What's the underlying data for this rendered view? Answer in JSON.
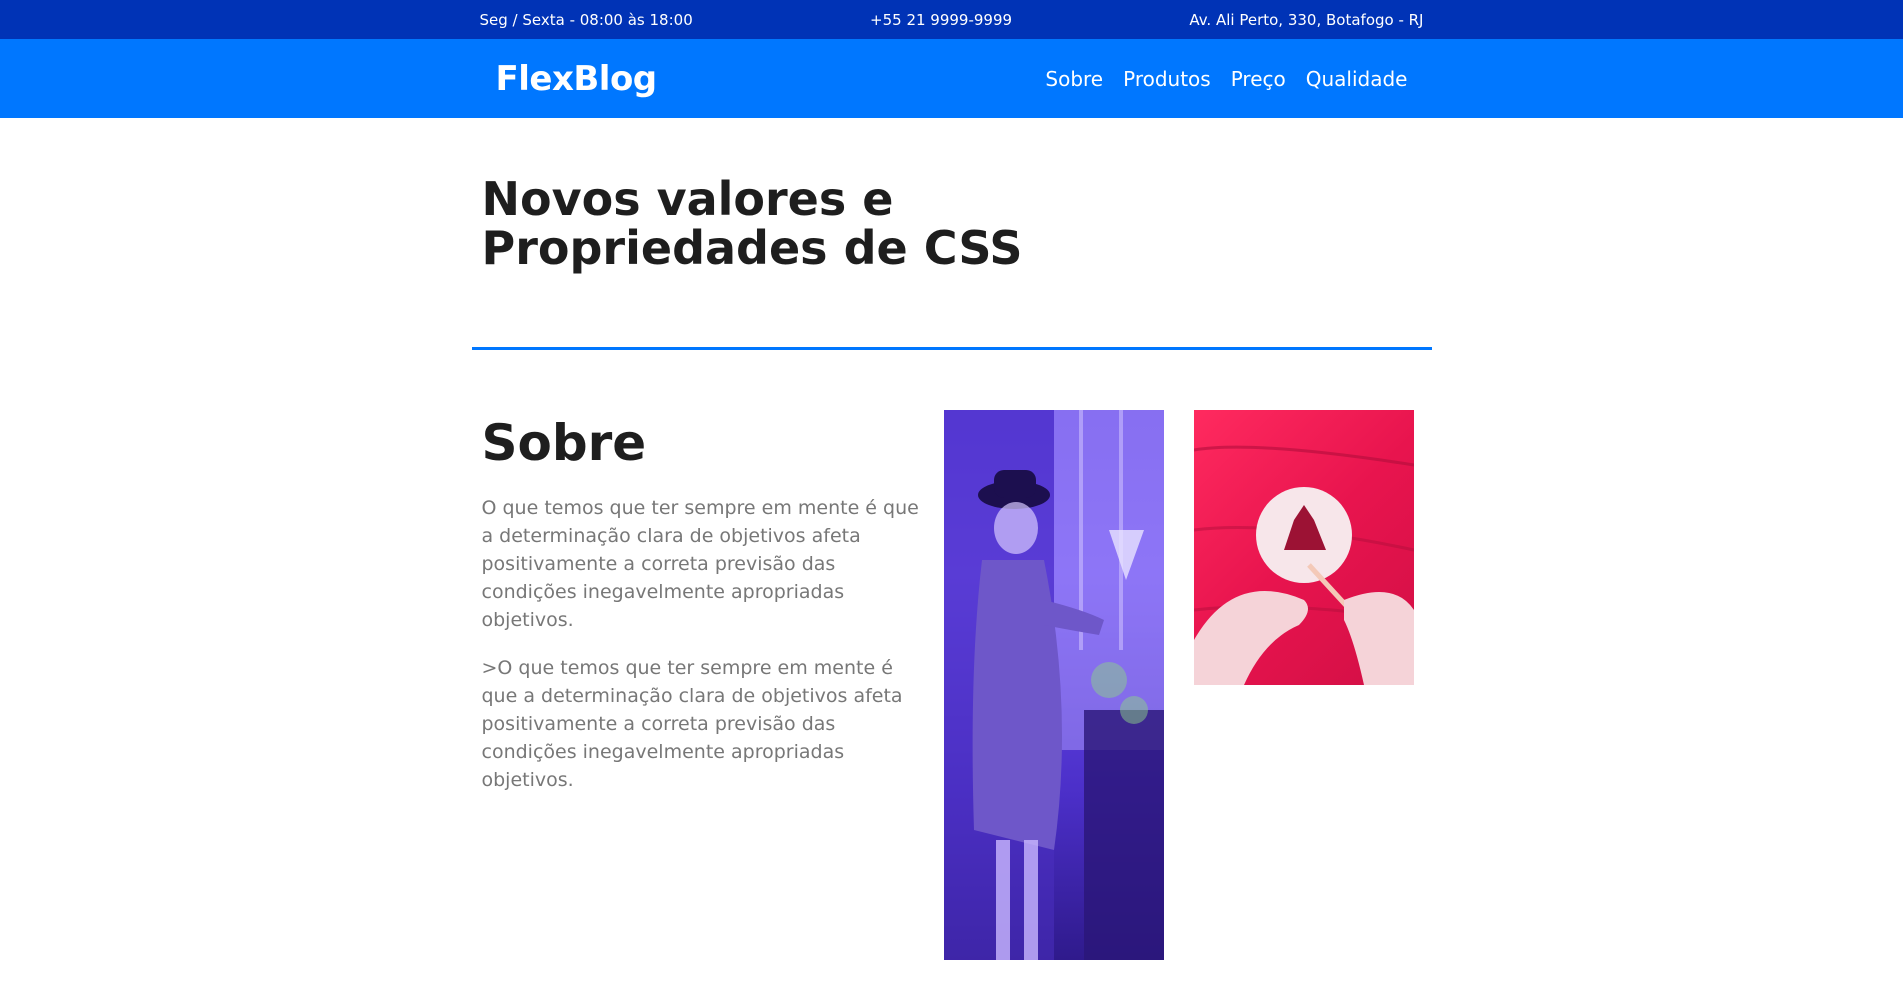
{
  "topbar": {
    "hours": "Seg / Sexta - 08:00 às 18:00",
    "phone": "+55 21 9999-9999",
    "address": "Av. Ali Perto, 330, Botafogo - RJ"
  },
  "nav": {
    "logo": "FlexBlog",
    "items": [
      {
        "label": "Sobre"
      },
      {
        "label": "Produtos"
      },
      {
        "label": "Preço"
      },
      {
        "label": "Qualidade"
      }
    ]
  },
  "hero": {
    "title_line1": "Novos valores e",
    "title_line2": "Propriedades de CSS"
  },
  "about": {
    "heading": "Sobre",
    "paragraph1": "O que temos que ter sempre em mente é que a determinação clara de objetivos afeta positivamente a correta previsão das condições inegavelmente apropriadas objetivos.",
    "paragraph2": ">O que temos que ter sempre em mente é que a determinação clara de objetivos afeta positivamente a correta previsão das condições inegavelmente apropriadas objetivos."
  },
  "colors": {
    "topbar": "#0033b6",
    "navbar": "#0077ff",
    "accent": "#0077ff",
    "text_muted": "#777777"
  }
}
